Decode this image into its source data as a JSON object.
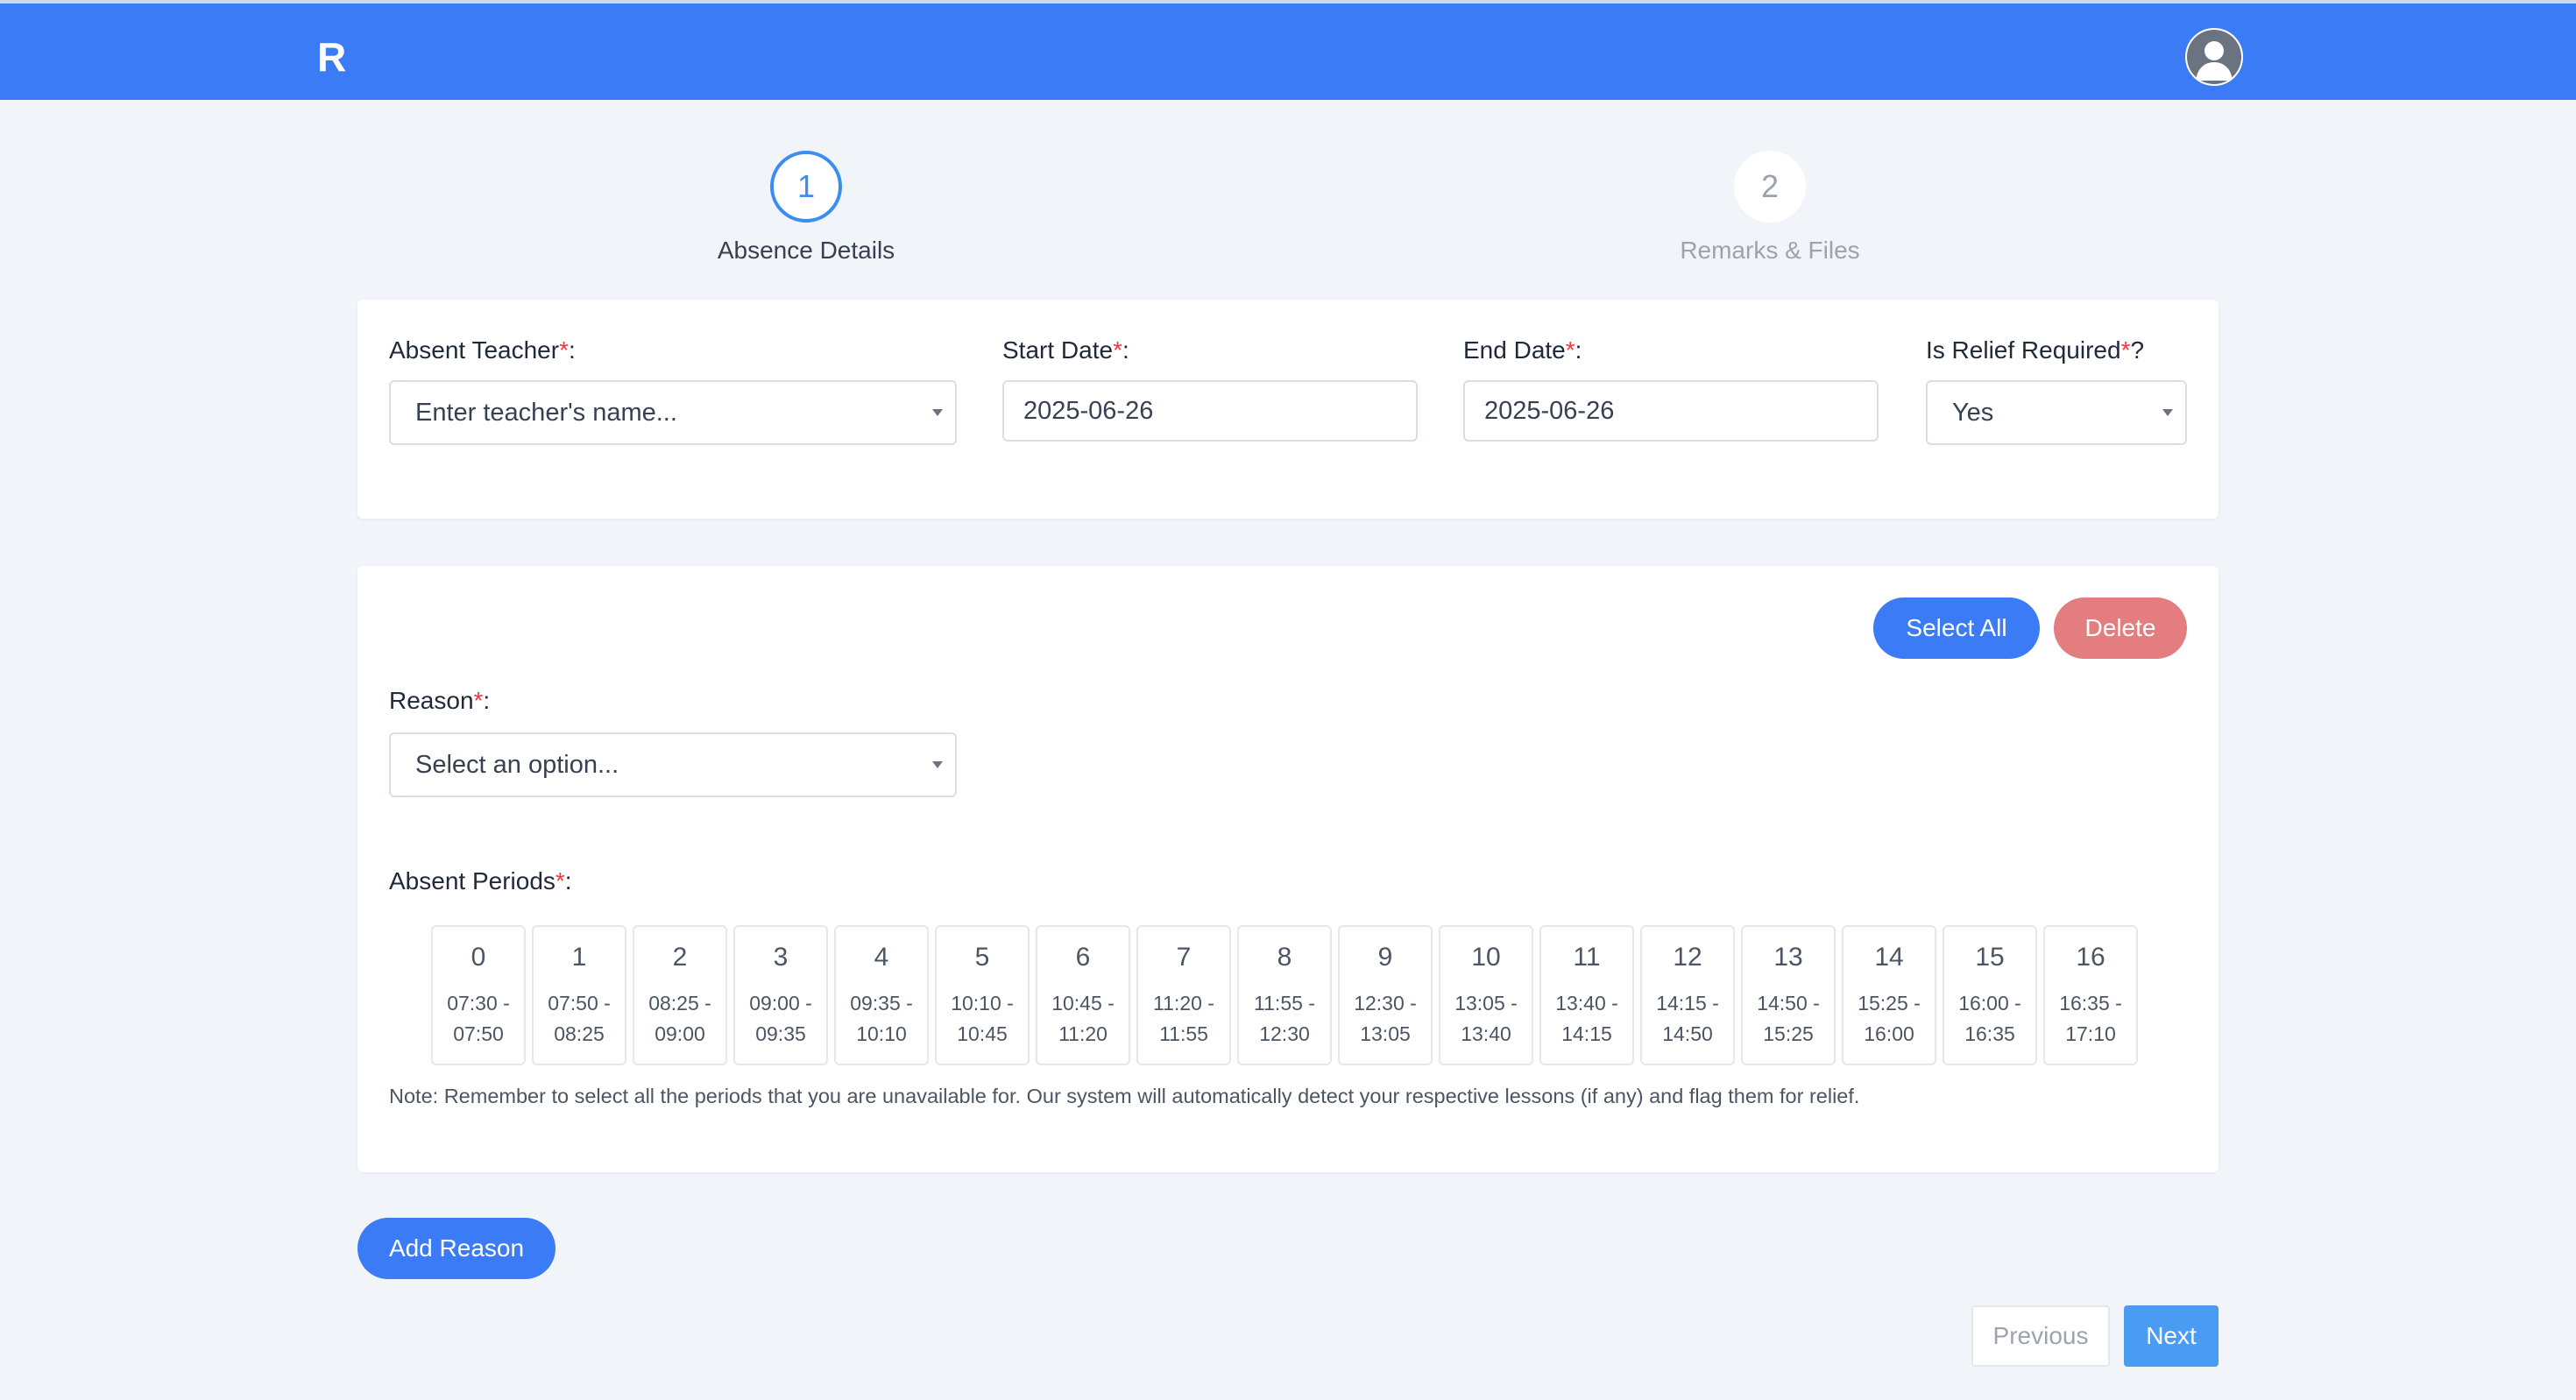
{
  "header": {
    "logo_text": "R",
    "brand_color": "#3b7cf6"
  },
  "stepper": {
    "steps": [
      {
        "number": "1",
        "label": "Absence Details",
        "active": true
      },
      {
        "number": "2",
        "label": "Remarks & Files",
        "active": false
      }
    ]
  },
  "absence_form": {
    "teacher": {
      "label": "Absent Teacher",
      "suffix": ":",
      "placeholder": "Enter teacher's name..."
    },
    "start_date": {
      "label": "Start Date",
      "suffix": ":",
      "value": "2025-06-26"
    },
    "end_date": {
      "label": "End Date",
      "suffix": ":",
      "value": "2025-06-26"
    },
    "relief": {
      "label": "Is Relief Required",
      "suffix": "?",
      "value": "Yes"
    },
    "required_marker": "*"
  },
  "reason_card": {
    "select_all_label": "Select All",
    "delete_label": "Delete",
    "reason": {
      "label": "Reason",
      "suffix": ":",
      "placeholder": "Select an option..."
    },
    "periods_label": "Absent Periods",
    "periods_suffix": ":",
    "periods": [
      {
        "num": "0",
        "start": "07:30 -",
        "end": "07:50"
      },
      {
        "num": "1",
        "start": "07:50 -",
        "end": "08:25"
      },
      {
        "num": "2",
        "start": "08:25 -",
        "end": "09:00"
      },
      {
        "num": "3",
        "start": "09:00 -",
        "end": "09:35"
      },
      {
        "num": "4",
        "start": "09:35 -",
        "end": "10:10"
      },
      {
        "num": "5",
        "start": "10:10 -",
        "end": "10:45"
      },
      {
        "num": "6",
        "start": "10:45 -",
        "end": "11:20"
      },
      {
        "num": "7",
        "start": "11:20 -",
        "end": "11:55"
      },
      {
        "num": "8",
        "start": "11:55 -",
        "end": "12:30"
      },
      {
        "num": "9",
        "start": "12:30 -",
        "end": "13:05"
      },
      {
        "num": "10",
        "start": "13:05 -",
        "end": "13:40"
      },
      {
        "num": "11",
        "start": "13:40 -",
        "end": "14:15"
      },
      {
        "num": "12",
        "start": "14:15 -",
        "end": "14:50"
      },
      {
        "num": "13",
        "start": "14:50 -",
        "end": "15:25"
      },
      {
        "num": "14",
        "start": "15:25 -",
        "end": "16:00"
      },
      {
        "num": "15",
        "start": "16:00 -",
        "end": "16:35"
      },
      {
        "num": "16",
        "start": "16:35 -",
        "end": "17:10"
      }
    ],
    "note": "Note: Remember to select all the periods that you are unavailable for. Our system will automatically detect your respective lessons (if any) and flag them for relief."
  },
  "actions": {
    "add_reason_label": "Add Reason",
    "previous_label": "Previous",
    "next_label": "Next"
  }
}
